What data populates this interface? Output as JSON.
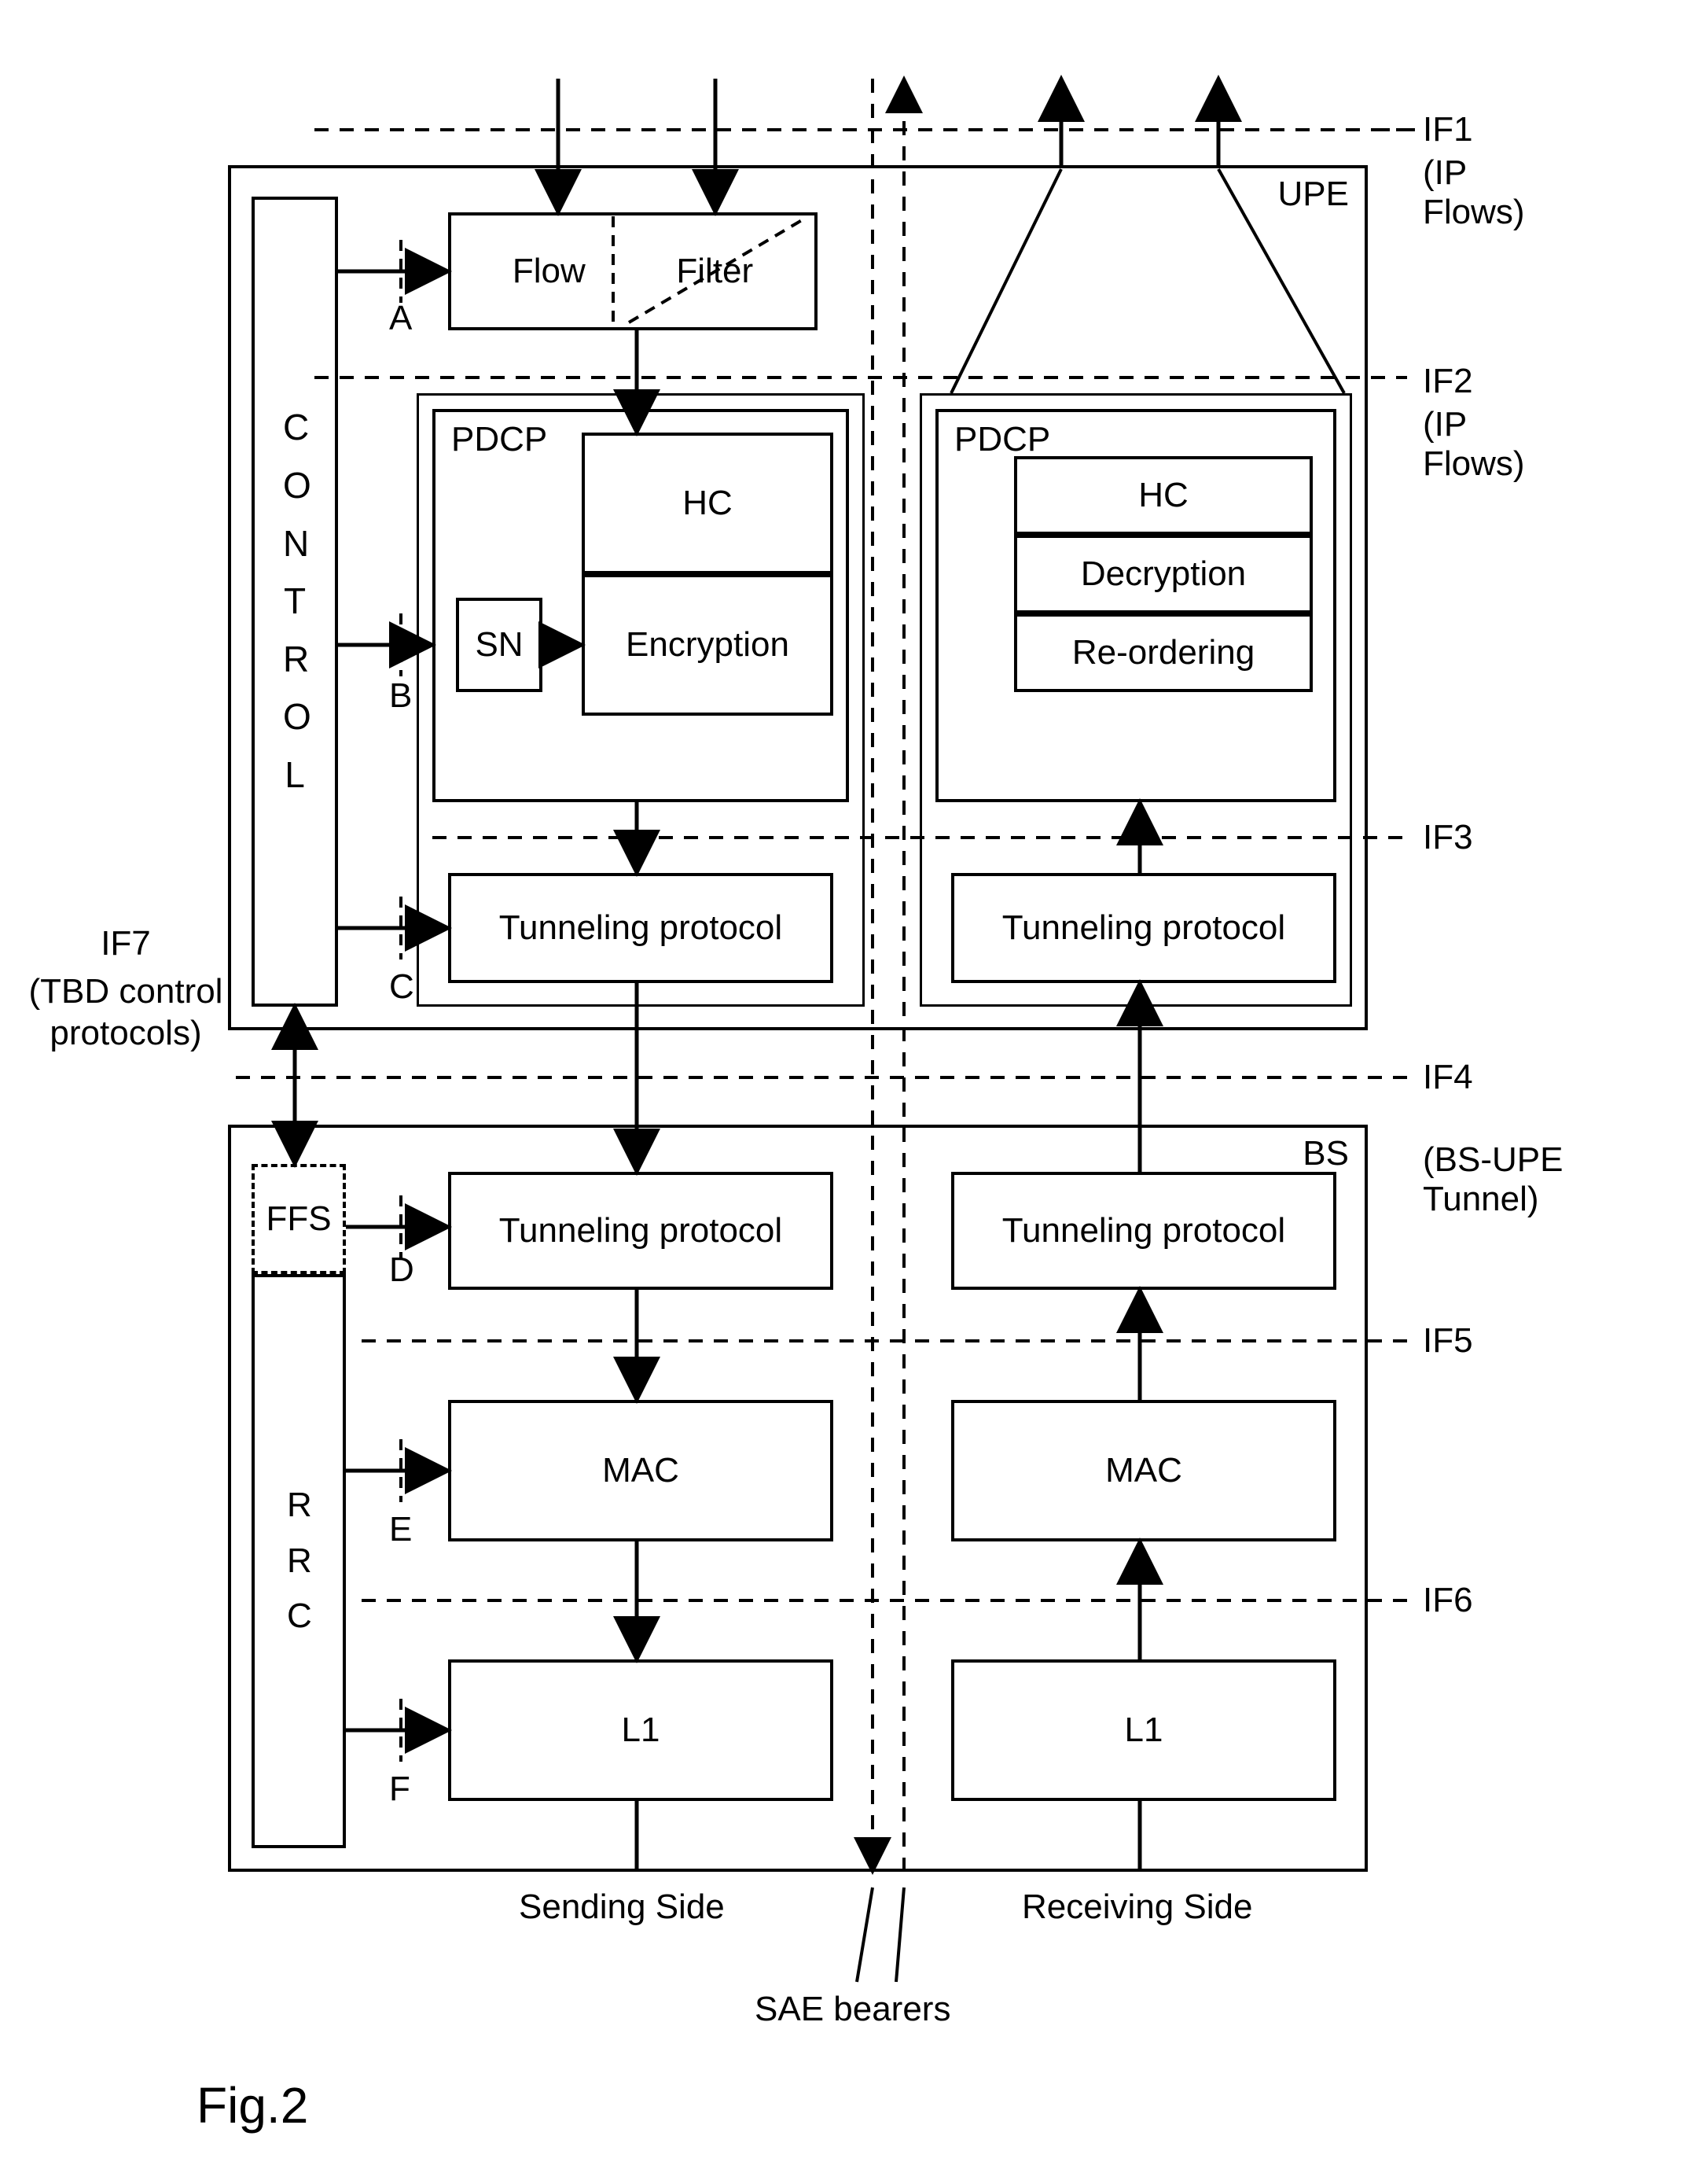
{
  "figure_label": "Fig.2",
  "upe": {
    "title": "UPE",
    "control": "CONTROL",
    "flow": "Flow",
    "filter": "Filter",
    "pdcp_send": "PDCP",
    "hc_send": "HC",
    "sn": "SN",
    "encryption": "Encryption",
    "tunnel_send": "Tunneling protocol",
    "pdcp_recv": "PDCP",
    "hc_recv": "HC",
    "decryption": "Decryption",
    "reordering": "Re-ordering",
    "tunnel_recv": "Tunneling protocol"
  },
  "bs": {
    "title": "BS",
    "ffs": "FFS",
    "rrc": "RRC",
    "tunnel_send": "Tunneling protocol",
    "mac_send": "MAC",
    "l1_send": "L1",
    "tunnel_recv": "Tunneling protocol",
    "mac_recv": "MAC",
    "l1_recv": "L1"
  },
  "interfaces": {
    "if1": "IF1",
    "if1_note": "(IP Flows)",
    "if2": "IF2",
    "if2_note": "(IP Flows)",
    "if3": "IF3",
    "if4": "IF4",
    "if4_note": "(BS-UPE Tunnel)",
    "if5": "IF5",
    "if6": "IF6",
    "if7": "IF7",
    "if7_note": "(TBD control protocols)"
  },
  "control_points": {
    "a": "A",
    "b": "B",
    "c": "C",
    "d": "D",
    "e": "E",
    "f": "F"
  },
  "bottom": {
    "sending": "Sending Side",
    "receiving": "Receiving Side",
    "sae": "SAE bearers"
  }
}
